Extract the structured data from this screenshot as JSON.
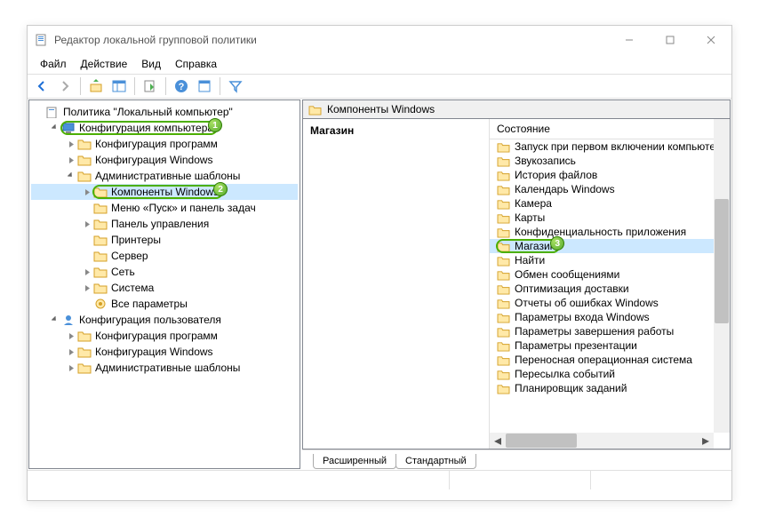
{
  "window": {
    "title": "Редактор локальной групповой политики"
  },
  "menu": {
    "file": "Файл",
    "action": "Действие",
    "view": "Вид",
    "help": "Справка"
  },
  "tree": {
    "root": "Политика \"Локальный компьютер\"",
    "comp_config": "Конфигурация компьютера",
    "comp_children": {
      "soft": "Конфигурация программ",
      "win": "Конфигурация Windows",
      "admin": "Административные шаблоны",
      "admin_children": {
        "components": "Компоненты Windows",
        "start": "Меню «Пуск» и панель задач",
        "cp": "Панель управления",
        "printers": "Принтеры",
        "server": "Сервер",
        "network": "Сеть",
        "system": "Система",
        "all": "Все параметры"
      }
    },
    "user_config": "Конфигурация пользователя",
    "user_children": {
      "soft": "Конфигурация программ",
      "win": "Конфигурация Windows",
      "admin": "Административные шаблоны"
    }
  },
  "panel": {
    "header": "Компоненты Windows",
    "detail_title": "Магазин",
    "list_header": "Состояние",
    "items": [
      "Запуск при первом включении компьюте",
      "Звукозапись",
      "История файлов",
      "Календарь Windows",
      "Камера",
      "Карты",
      "Конфиденциальность приложения",
      "Магазин",
      "Найти",
      "Обмен сообщениями",
      "Оптимизация доставки",
      "Отчеты об ошибках Windows",
      "Параметры входа Windows",
      "Параметры завершения работы",
      "Параметры презентации",
      "Переносная операционная система",
      "Пересылка событий",
      "Планировщик заданий"
    ],
    "selected_idx": 7
  },
  "tabs": {
    "extended": "Расширенный",
    "standard": "Стандартный"
  },
  "badges": {
    "b1": "1",
    "b2": "2",
    "b3": "3"
  }
}
